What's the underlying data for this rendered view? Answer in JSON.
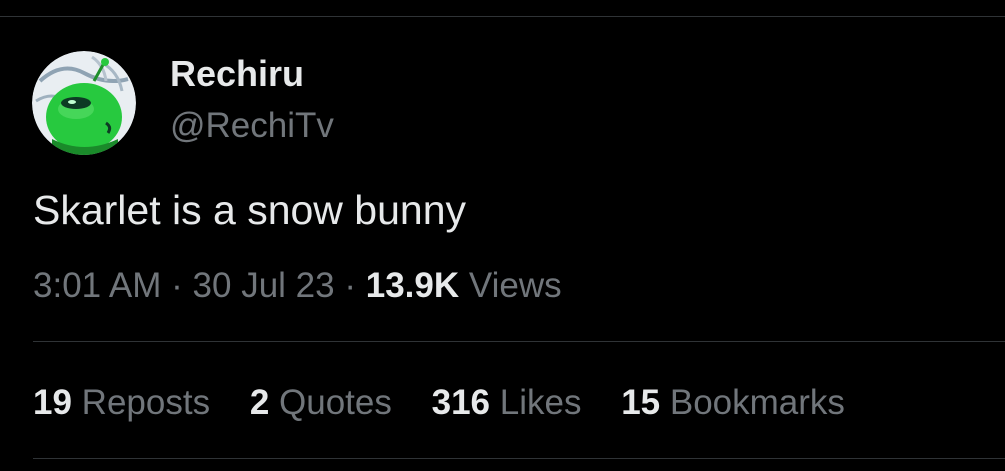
{
  "author": {
    "display_name": "Rechiru",
    "handle": "@RechiTv",
    "avatar_icon": "green-alien-avatar"
  },
  "tweet": {
    "text": "Skarlet is a snow bunny"
  },
  "meta": {
    "time": "3:01 AM",
    "separator": "·",
    "date": "30 Jul 23",
    "views_count": "13.9K",
    "views_label": "Views"
  },
  "stats": [
    {
      "count": "19",
      "label": "Reposts"
    },
    {
      "count": "2",
      "label": "Quotes"
    },
    {
      "count": "316",
      "label": "Likes"
    },
    {
      "count": "15",
      "label": "Bookmarks"
    }
  ],
  "colors": {
    "background": "#000000",
    "primary_text": "#e7e9ea",
    "secondary_text": "#71767b",
    "divider": "#2f3336",
    "avatar_green": "#27c93f"
  }
}
